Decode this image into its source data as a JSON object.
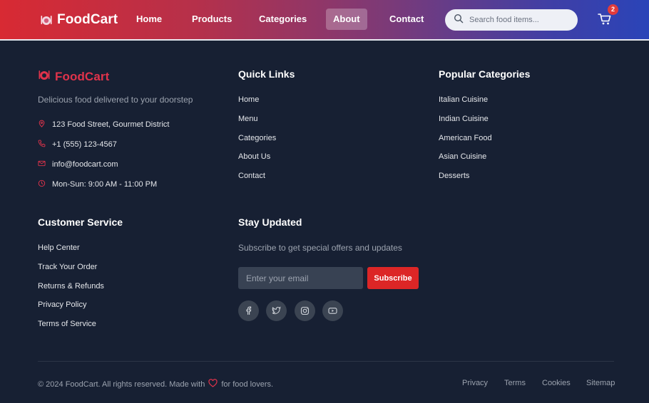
{
  "header": {
    "brand": "FoodCart",
    "nav": [
      {
        "label": "Home"
      },
      {
        "label": "Products"
      },
      {
        "label": "Categories"
      },
      {
        "label": "About",
        "active": true
      },
      {
        "label": "Contact"
      }
    ],
    "search_placeholder": "Search food items...",
    "cart_count": "2"
  },
  "footer": {
    "brand": "FoodCart",
    "tagline": "Delicious food delivered to your doorstep",
    "contact": {
      "address": "123 Food Street, Gourmet District",
      "phone": "+1 (555) 123-4567",
      "email": "info@foodcart.com",
      "hours": "Mon-Sun: 9:00 AM - 11:00 PM"
    },
    "quick_links": {
      "title": "Quick Links",
      "items": [
        "Home",
        "Menu",
        "Categories",
        "About Us",
        "Contact"
      ]
    },
    "popular_categories": {
      "title": "Popular Categories",
      "items": [
        "Italian Cuisine",
        "Indian Cuisine",
        "American Food",
        "Asian Cuisine",
        "Desserts"
      ]
    },
    "customer_service": {
      "title": "Customer Service",
      "items": [
        "Help Center",
        "Track Your Order",
        "Returns & Refunds",
        "Privacy Policy",
        "Terms of Service"
      ]
    },
    "newsletter": {
      "title": "Stay Updated",
      "text": "Subscribe to get special offers and updates",
      "placeholder": "Enter your email",
      "button": "Subscribe"
    },
    "social_icons": [
      "facebook-icon",
      "twitter-icon",
      "instagram-icon",
      "youtube-icon"
    ],
    "copyright_before": "© 2024 FoodCart. All rights reserved. Made with",
    "copyright_after": "for food lovers.",
    "bottom_links": [
      "Privacy",
      "Terms",
      "Cookies",
      "Sitemap"
    ]
  },
  "colors": {
    "accent_red": "#dc2626",
    "brand_footer": "#e0334b",
    "background": "#172033"
  }
}
